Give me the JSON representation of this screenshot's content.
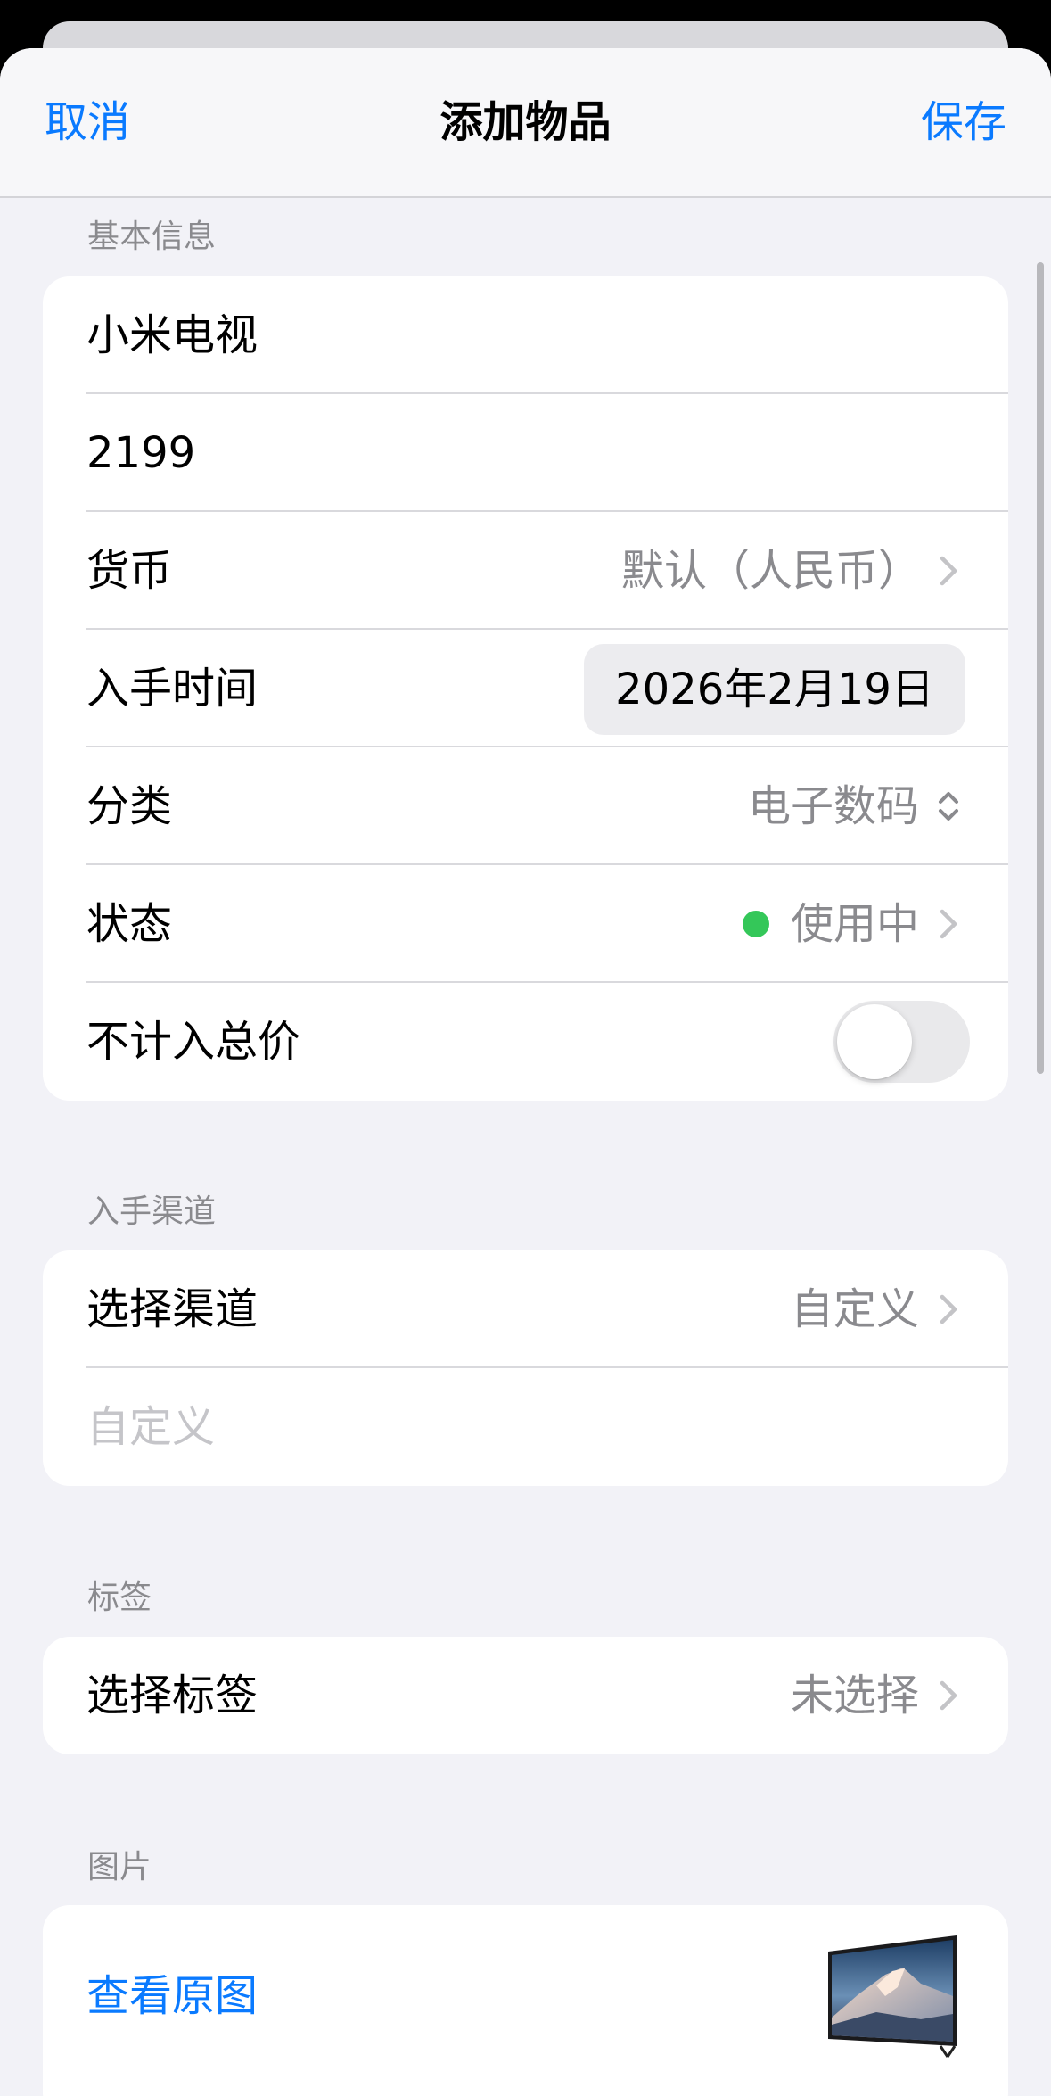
{
  "nav": {
    "cancel": "取消",
    "title": "添加物品",
    "save": "保存"
  },
  "basic_info": {
    "header": "基本信息",
    "name_value": "小米电视",
    "price_value": "2199",
    "currency": {
      "label": "货币",
      "value": "默认（人民币）"
    },
    "acquired": {
      "label": "入手时间",
      "value": "2026年2月19日"
    },
    "category": {
      "label": "分类",
      "value": "电子数码"
    },
    "status": {
      "label": "状态",
      "value": "使用中",
      "dot_color": "#34c759"
    },
    "exclude_total": {
      "label": "不计入总价",
      "on": false
    }
  },
  "channel": {
    "header": "入手渠道",
    "select": {
      "label": "选择渠道",
      "value": "自定义"
    },
    "custom_placeholder": "自定义"
  },
  "tags": {
    "header": "标签",
    "select": {
      "label": "选择标签",
      "value": "未选择"
    }
  },
  "images": {
    "header": "图片",
    "view_original": "查看原图"
  },
  "colors": {
    "accent": "#0a7aff",
    "background": "#f2f2f7",
    "secondary_text": "#8a8a8e"
  }
}
